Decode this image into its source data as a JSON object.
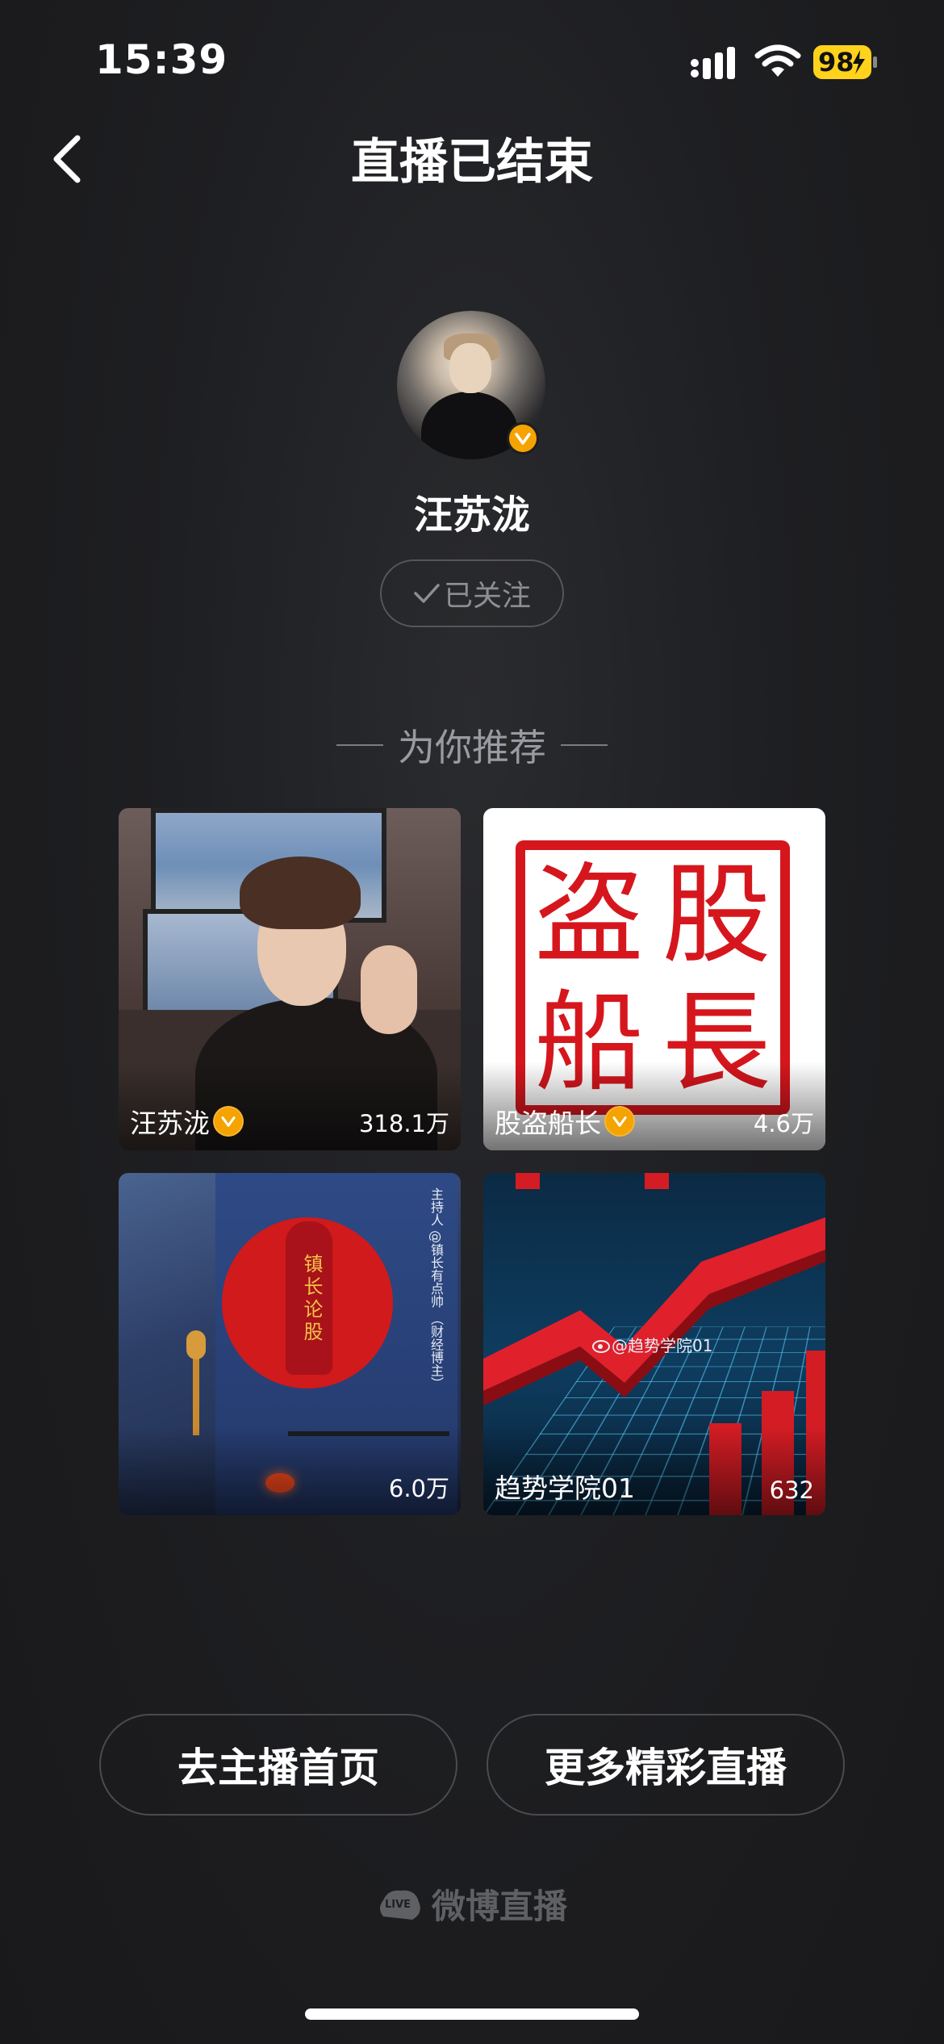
{
  "status_bar": {
    "time": "15:39",
    "battery": "98"
  },
  "header": {
    "title": "直播已结束"
  },
  "streamer": {
    "name": "汪苏泷",
    "follow_label": "已关注"
  },
  "recommend": {
    "heading": "为你推荐",
    "cards": [
      {
        "name": "汪苏泷",
        "views": "318.1万",
        "verified": true
      },
      {
        "name": "股盗船长",
        "views": "4.6万",
        "verified": true,
        "seal_chars": [
          "盗",
          "股",
          "船",
          "長"
        ]
      },
      {
        "name": "",
        "views": "6.0万",
        "verified": false,
        "poster_title": "镇长论股",
        "poster_side": "主持人 @镇长有点帅 （财经博主）"
      },
      {
        "name": "趋势学院01",
        "views": "632",
        "verified": false,
        "watermark": "@趋势学院01"
      }
    ]
  },
  "buttons": {
    "home": "去主播首页",
    "more": "更多精彩直播"
  },
  "brand": {
    "logo_text": "LIVE",
    "label": "微博直播"
  },
  "colors": {
    "verified_badge": "#f5a300",
    "seal_red": "#d6161d",
    "background": "#1e1f22"
  }
}
